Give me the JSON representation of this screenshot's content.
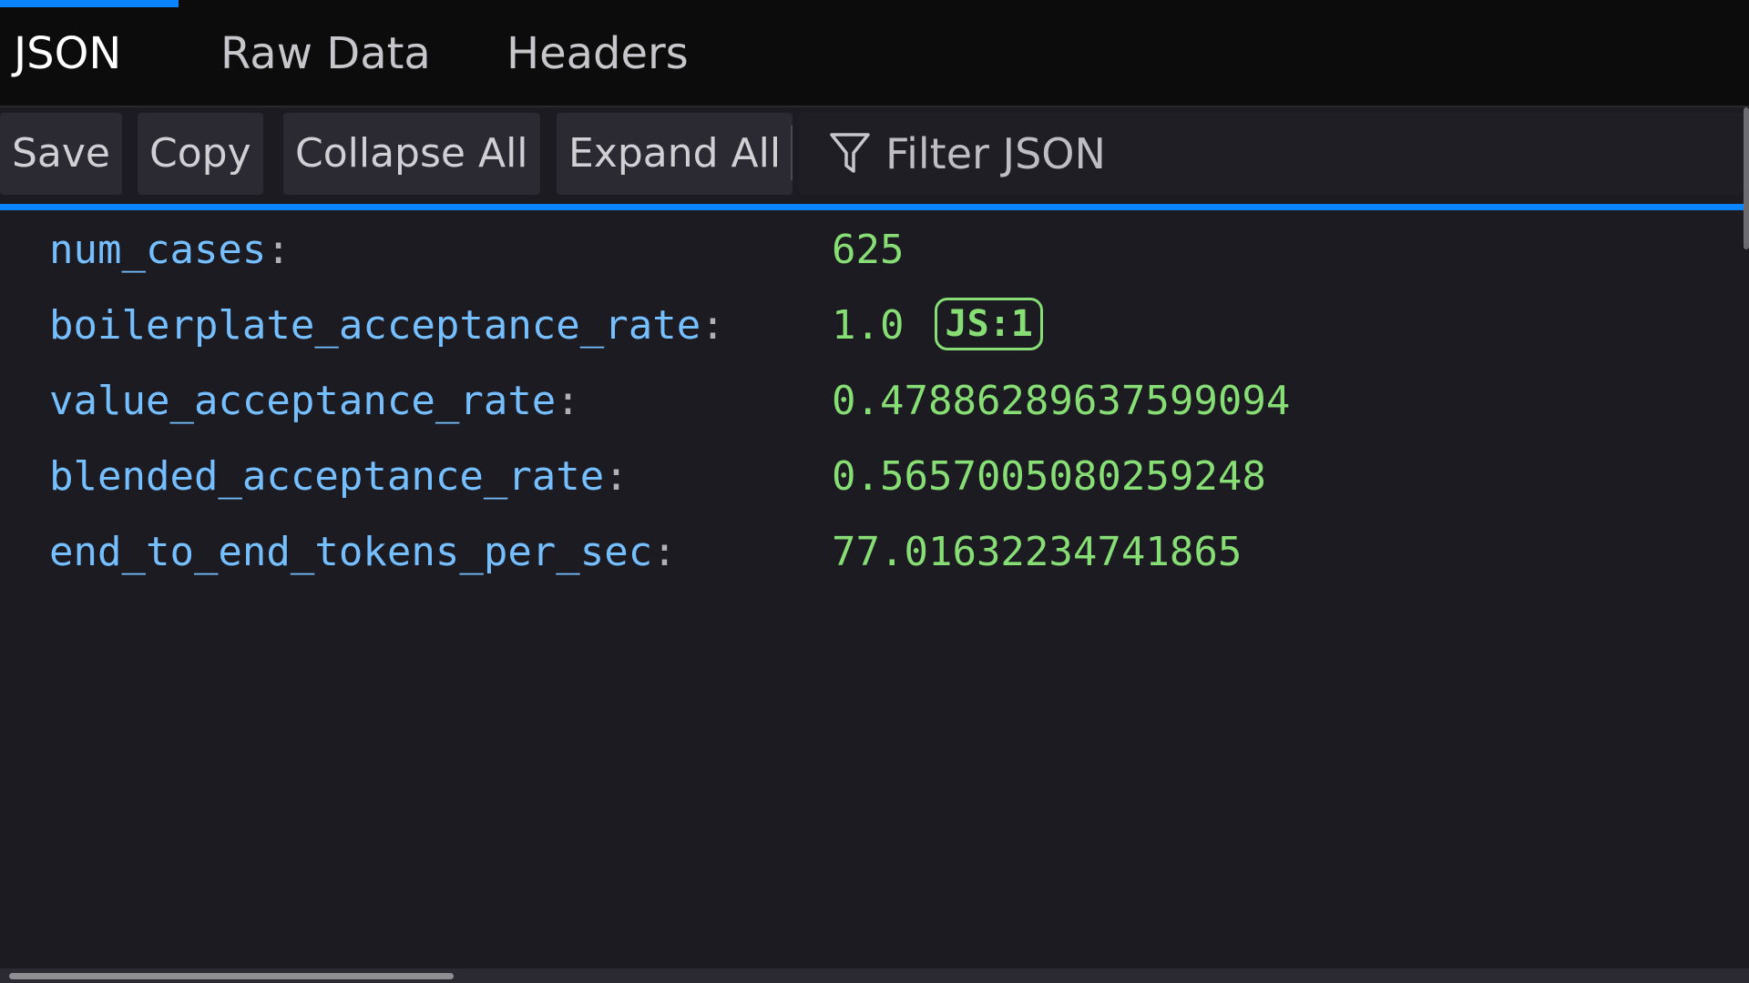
{
  "tabs": [
    {
      "label": "JSON",
      "active": true
    },
    {
      "label": "Raw Data",
      "active": false
    },
    {
      "label": "Headers",
      "active": false
    }
  ],
  "toolbar": {
    "save_label": "Save",
    "copy_label": "Copy",
    "collapse_label": "Collapse All",
    "expand_label": "Expand All",
    "filter_placeholder": "Filter JSON",
    "filter_icon": "filter-icon"
  },
  "json_rows": [
    {
      "key": "num_cases",
      "colon": ":",
      "value": "625"
    },
    {
      "key": "boilerplate_acceptance_rate",
      "colon": ":",
      "value": "1.0",
      "badge": "JS:1"
    },
    {
      "key": "value_acceptance_rate",
      "colon": ":",
      "value": "0.47886289637599094"
    },
    {
      "key": "blended_acceptance_rate",
      "colon": ":",
      "value": "0.5657005080259248"
    },
    {
      "key": "end_to_end_tokens_per_sec",
      "colon": ":",
      "value": "77.01632234741865"
    }
  ],
  "colors": {
    "accent": "#0a84ff",
    "key": "#75bfff",
    "value": "#86de74",
    "background": "#1c1b22"
  }
}
